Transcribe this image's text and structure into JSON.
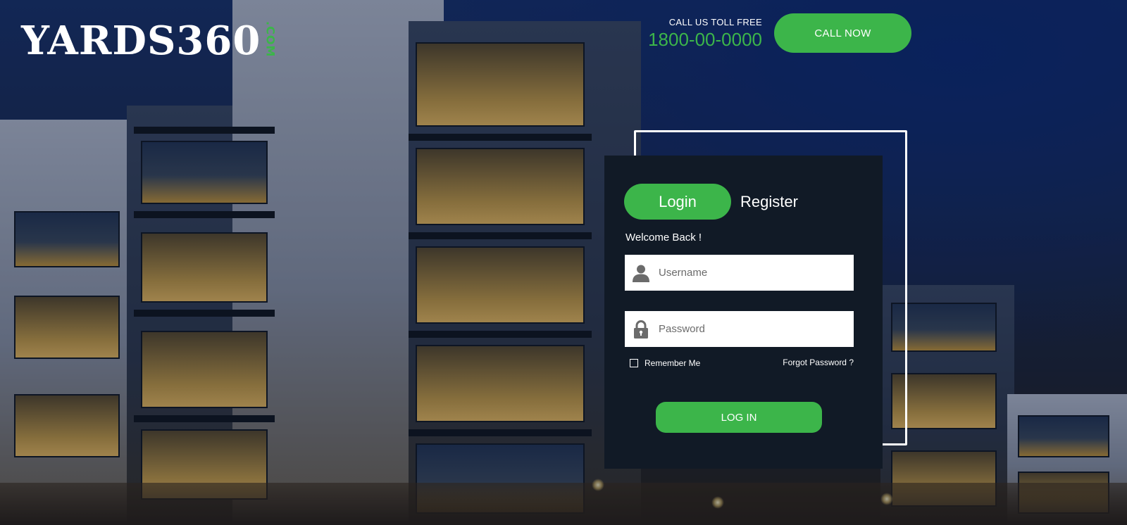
{
  "header": {
    "logo": {
      "main_text": "YARDS360",
      "suffix": ".COM"
    },
    "toll_free": {
      "label": "CALL US TOLL FREE",
      "number": "1800-00-0000"
    },
    "call_button_label": "CALL NOW"
  },
  "login_card": {
    "tabs": {
      "login_label": "Login",
      "register_label": "Register"
    },
    "welcome_text": "Welcome Back !",
    "username": {
      "placeholder": "Username",
      "value": "",
      "icon": "user-icon"
    },
    "password": {
      "placeholder": "Password",
      "value": "",
      "icon": "lock-icon"
    },
    "remember_me_label": "Remember Me",
    "remember_me_checked": false,
    "forgot_password_label": "Forgot Password ?",
    "submit_label": "LOG IN"
  },
  "colors": {
    "accent": "#3cb54a",
    "card_background": "#111a26",
    "text_light": "#ffffff"
  }
}
